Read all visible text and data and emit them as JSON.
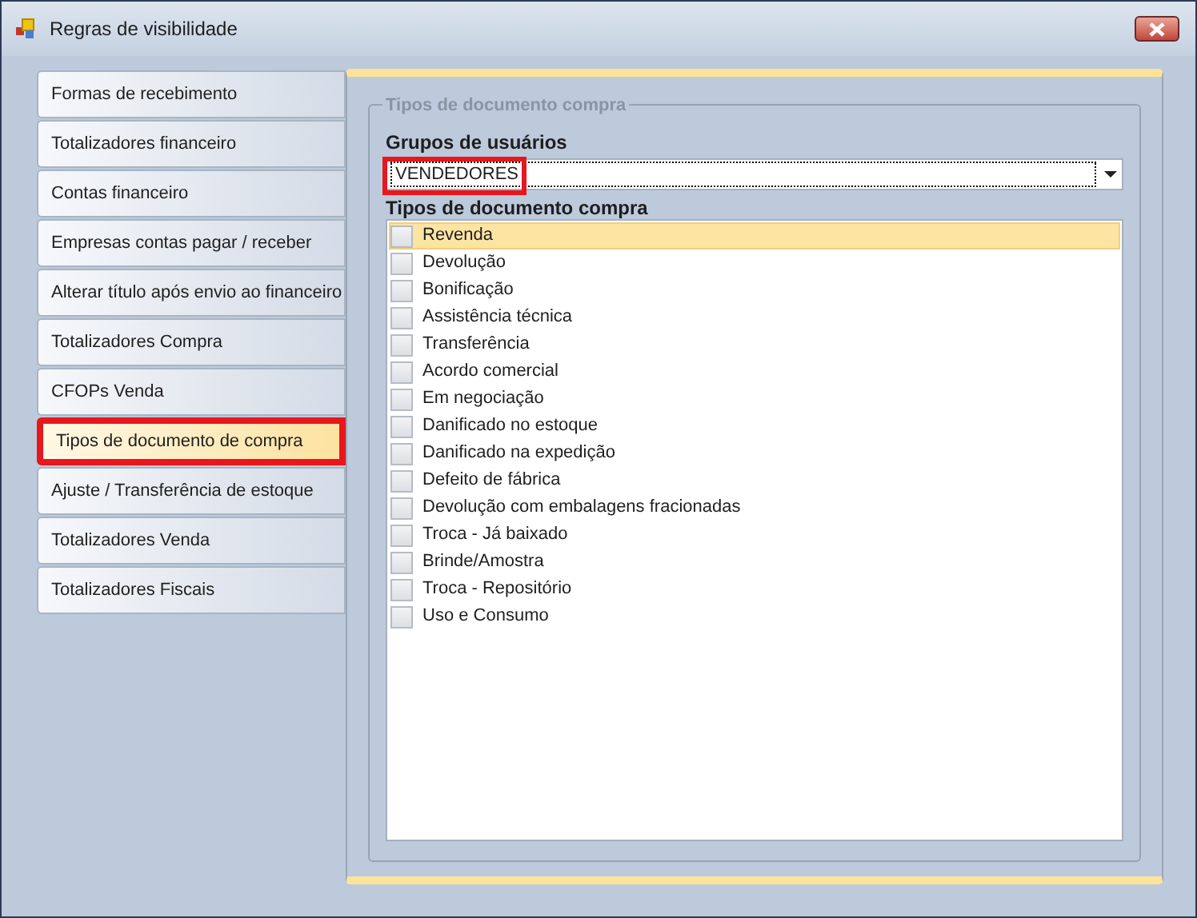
{
  "window": {
    "title": "Regras de visibilidade"
  },
  "nav": [
    {
      "label": "Formas de recebimento",
      "selected": false,
      "highlighted": false
    },
    {
      "label": "Totalizadores financeiro",
      "selected": false,
      "highlighted": false
    },
    {
      "label": "Contas financeiro",
      "selected": false,
      "highlighted": false
    },
    {
      "label": "Empresas contas pagar / receber",
      "selected": false,
      "highlighted": false
    },
    {
      "label": "Alterar título após envio ao financeiro",
      "selected": false,
      "highlighted": false
    },
    {
      "label": "Totalizadores Compra",
      "selected": false,
      "highlighted": false
    },
    {
      "label": "CFOPs Venda",
      "selected": false,
      "highlighted": false
    },
    {
      "label": "Tipos de documento de compra",
      "selected": true,
      "highlighted": true
    },
    {
      "label": "Ajuste / Transferência de estoque",
      "selected": false,
      "highlighted": false
    },
    {
      "label": "Totalizadores Venda",
      "selected": false,
      "highlighted": false
    },
    {
      "label": "Totalizadores Fiscais",
      "selected": false,
      "highlighted": false
    }
  ],
  "group": {
    "title": "Tipos de documento compra",
    "user_groups": {
      "label": "Grupos de usuários",
      "value": "VENDEDORES",
      "highlighted": true
    },
    "list_label": "Tipos de documento compra",
    "items": [
      {
        "label": "Revenda",
        "checked": false,
        "selected": true
      },
      {
        "label": "Devolução",
        "checked": false,
        "selected": false
      },
      {
        "label": "Bonificação",
        "checked": false,
        "selected": false
      },
      {
        "label": "Assistência técnica",
        "checked": false,
        "selected": false
      },
      {
        "label": "Transferência",
        "checked": false,
        "selected": false
      },
      {
        "label": "Acordo comercial",
        "checked": false,
        "selected": false
      },
      {
        "label": "Em negociação",
        "checked": false,
        "selected": false
      },
      {
        "label": "Danificado no estoque",
        "checked": false,
        "selected": false
      },
      {
        "label": "Danificado na expedição",
        "checked": false,
        "selected": false
      },
      {
        "label": "Defeito de fábrica",
        "checked": false,
        "selected": false
      },
      {
        "label": "Devolução com embalagens fracionadas",
        "checked": false,
        "selected": false
      },
      {
        "label": "Troca - Já baixado",
        "checked": false,
        "selected": false
      },
      {
        "label": "Brinde/Amostra",
        "checked": false,
        "selected": false
      },
      {
        "label": "Troca - Repositório",
        "checked": false,
        "selected": false
      },
      {
        "label": "Uso e Consumo",
        "checked": false,
        "selected": false
      }
    ]
  }
}
